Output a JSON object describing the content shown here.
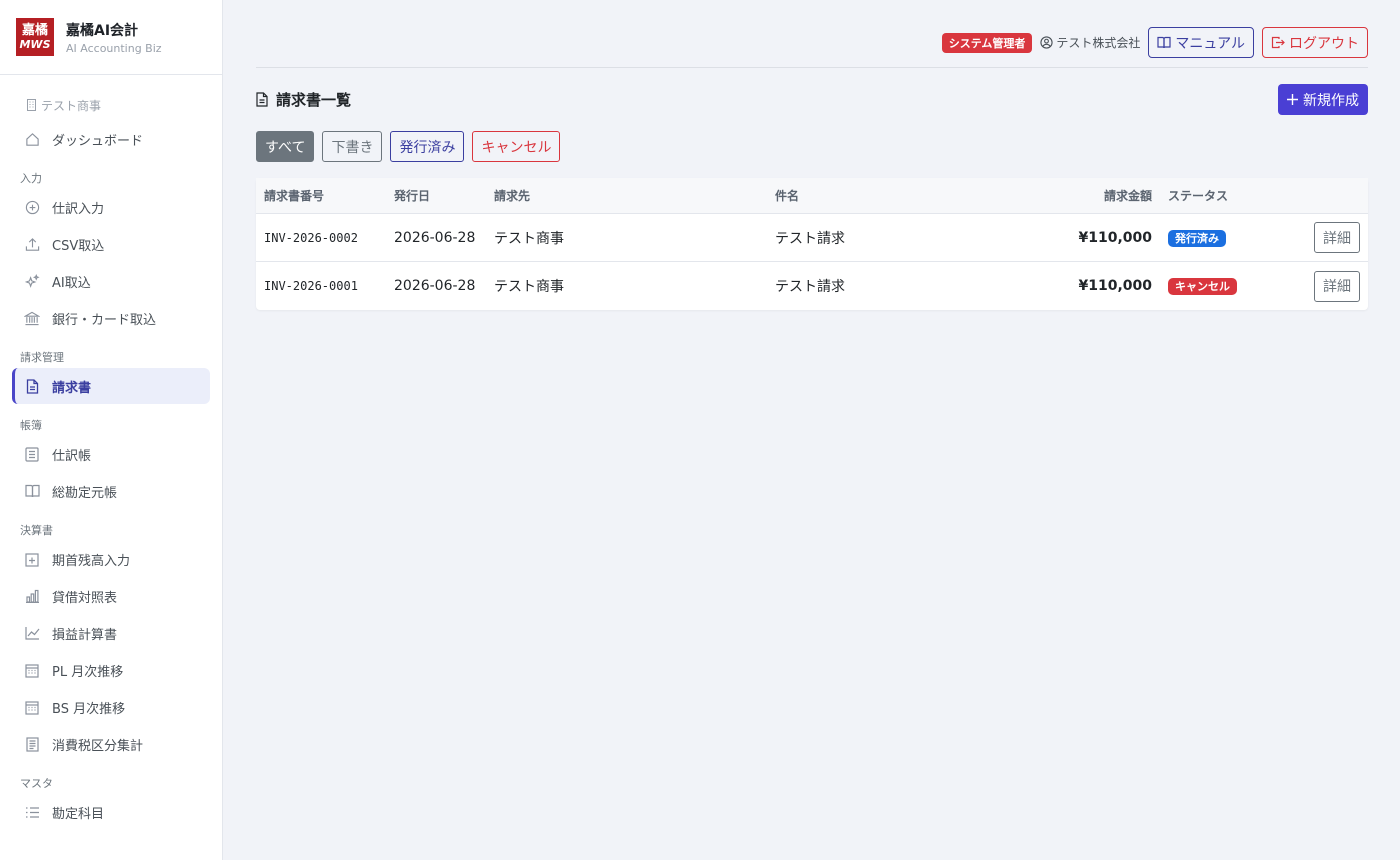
{
  "brand": {
    "logo_line1": "嘉橘",
    "logo_line2": "MWS",
    "name": "嘉橘AI会計",
    "sub": "AI Accounting Biz"
  },
  "sidebar": {
    "company": "テスト商事",
    "items": [
      {
        "type": "item",
        "label": "ダッシュボード",
        "icon": "home-icon"
      },
      {
        "type": "section",
        "label": "入力"
      },
      {
        "type": "item",
        "label": "仕訳入力",
        "icon": "plus-circle-icon"
      },
      {
        "type": "item",
        "label": "CSV取込",
        "icon": "upload-icon"
      },
      {
        "type": "item",
        "label": "AI取込",
        "icon": "sparkle-icon"
      },
      {
        "type": "item",
        "label": "銀行・カード取込",
        "icon": "bank-icon"
      },
      {
        "type": "section",
        "label": "請求管理"
      },
      {
        "type": "item",
        "label": "請求書",
        "icon": "document-icon",
        "active": true
      },
      {
        "type": "section",
        "label": "帳簿"
      },
      {
        "type": "item",
        "label": "仕訳帳",
        "icon": "journal-icon"
      },
      {
        "type": "item",
        "label": "総勘定元帳",
        "icon": "book-icon"
      },
      {
        "type": "section",
        "label": "決算書"
      },
      {
        "type": "item",
        "label": "期首残高入力",
        "icon": "calendar-plus-icon"
      },
      {
        "type": "item",
        "label": "貸借対照表",
        "icon": "bar-chart-icon"
      },
      {
        "type": "item",
        "label": "損益計算書",
        "icon": "line-chart-icon"
      },
      {
        "type": "item",
        "label": "PL 月次推移",
        "icon": "calendar-icon"
      },
      {
        "type": "item",
        "label": "BS 月次推移",
        "icon": "calendar-icon"
      },
      {
        "type": "item",
        "label": "消費税区分集計",
        "icon": "receipt-icon"
      },
      {
        "type": "section",
        "label": "マスタ"
      },
      {
        "type": "item",
        "label": "勘定科目",
        "icon": "list-icon"
      }
    ]
  },
  "topbar": {
    "admin_badge": "システム管理者",
    "user": "テスト株式会社",
    "manual": "マニュアル",
    "logout": "ログアウト"
  },
  "page": {
    "title": "請求書一覧",
    "new_button": "新規作成"
  },
  "filters": {
    "all": "すべて",
    "draft": "下書き",
    "issued": "発行済み",
    "cancel": "キャンセル"
  },
  "table": {
    "headers": {
      "no": "請求書番号",
      "date": "発行日",
      "client": "請求先",
      "subject": "件名",
      "amount": "請求金額",
      "status": "ステータス"
    },
    "rows": [
      {
        "no": "INV-2026-0002",
        "date": "2026-06-28",
        "client": "テスト商事",
        "subject": "テスト請求",
        "amount": "¥110,000",
        "status": "発行済み",
        "status_type": "issued",
        "action": "詳細"
      },
      {
        "no": "INV-2026-0001",
        "date": "2026-06-28",
        "client": "テスト商事",
        "subject": "テスト請求",
        "amount": "¥110,000",
        "status": "キャンセル",
        "status_type": "cancel",
        "action": "詳細"
      }
    ]
  },
  "colors": {
    "primary": "#4a3fd4",
    "danger": "#d9363e",
    "info": "#1b6fe0",
    "brand_red": "#b51f24"
  }
}
